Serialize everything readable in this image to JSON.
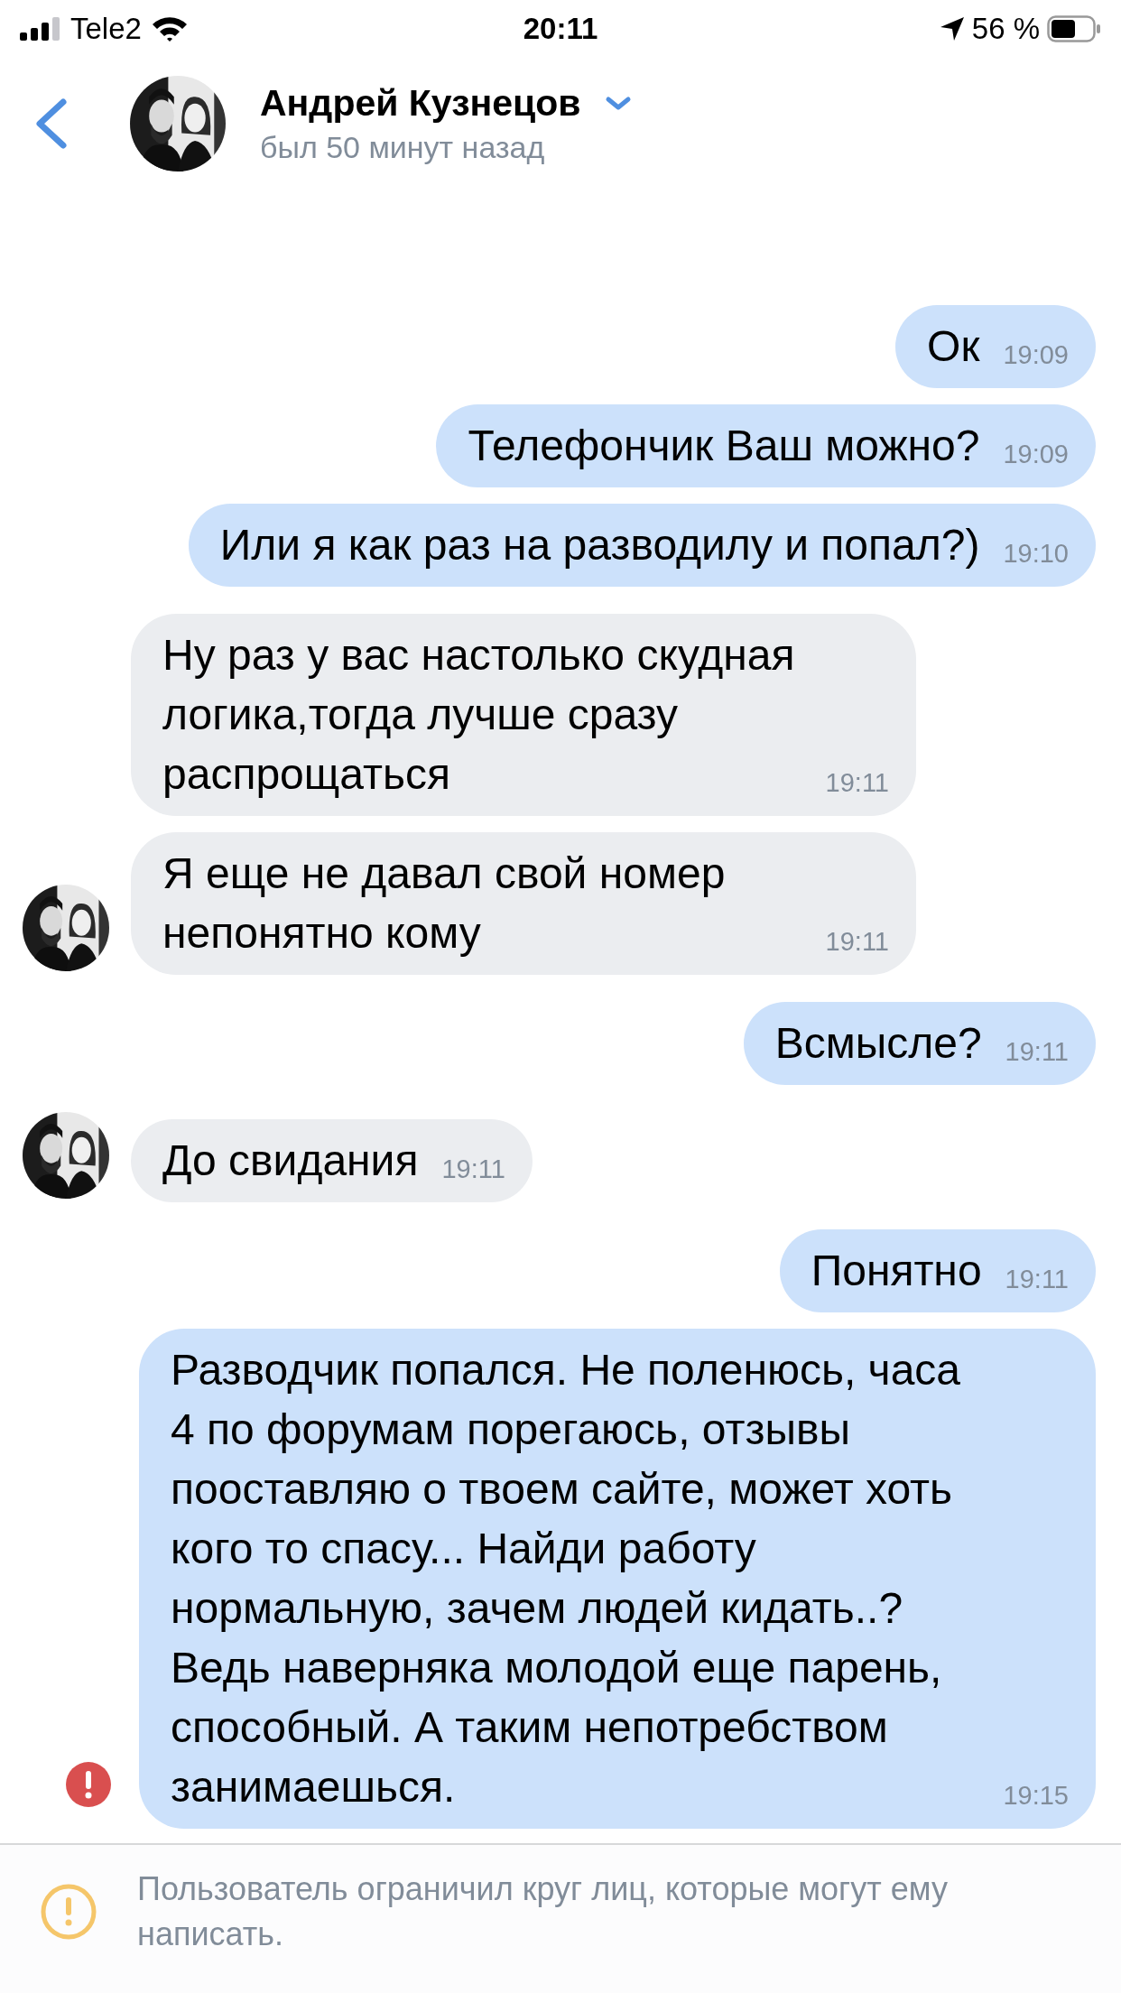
{
  "status_bar": {
    "carrier": "Tele2",
    "time": "20:11",
    "battery": "56 %"
  },
  "header": {
    "name": "Андрей Кузнецов",
    "status": "был 50 минут назад"
  },
  "messages": [
    {
      "kind": "out",
      "text": "Ок",
      "time": "19:09",
      "avatar": false,
      "error": false
    },
    {
      "kind": "out",
      "text": "Телефончик Ваш можно?",
      "time": "19:09",
      "avatar": false,
      "error": false
    },
    {
      "kind": "out",
      "text": "Или я как раз на разводилу и попал?)",
      "time": "19:10",
      "avatar": false,
      "error": false
    },
    {
      "kind": "in",
      "text": "Ну раз у вас настолько скудная логика,тогда лучше сразу распрощаться",
      "time": "19:11",
      "avatar": false,
      "error": false
    },
    {
      "kind": "in",
      "text": "Я еще не давал свой номер непонятно кому",
      "time": "19:11",
      "avatar": true,
      "error": false
    },
    {
      "kind": "out",
      "text": "Всмысле?",
      "time": "19:11",
      "avatar": false,
      "error": false
    },
    {
      "kind": "in",
      "text": "До свидания",
      "time": "19:11",
      "avatar": true,
      "error": false
    },
    {
      "kind": "out",
      "text": "Понятно",
      "time": "19:11",
      "avatar": false,
      "error": false
    },
    {
      "kind": "out",
      "text": "Разводчик попался. Не поленюсь, часа 4 по форумам порегаюсь, отзывы пооставляю о твоем сайте, может хоть кого то спасу... Найди работу нормальную, зачем людей кидать..? Ведь наверняка молодой еще парень, способный. А таким непотребством занимаешься.",
      "time": "19:15",
      "avatar": false,
      "error": true
    }
  ],
  "footer": {
    "notice": "Пользователь ограничил круг лиц, которые могут ему написать."
  }
}
